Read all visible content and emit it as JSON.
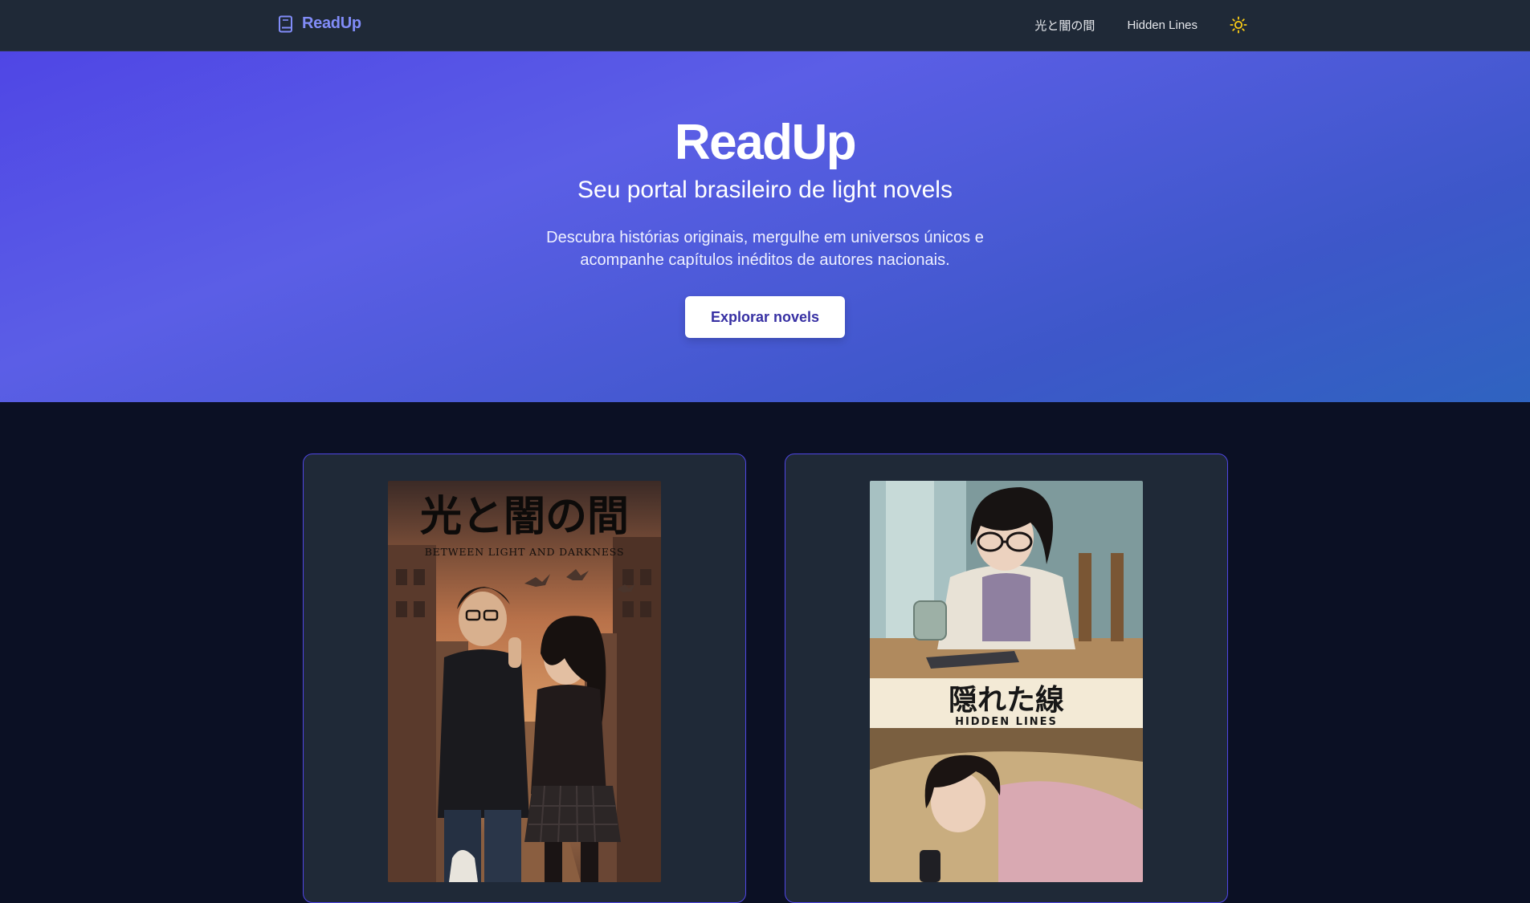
{
  "header": {
    "brand": "ReadUp",
    "nav": [
      {
        "label": "光と闇の間"
      },
      {
        "label": "Hidden Lines"
      }
    ],
    "theme_icon": "sun-icon"
  },
  "hero": {
    "title": "ReadUp",
    "subtitle": "Seu portal brasileiro de light novels",
    "description": "Descubra histórias originais, mergulhe em universos únicos e acompanhe capítulos inéditos de autores nacionais.",
    "cta": "Explorar novels"
  },
  "novels": [
    {
      "cover_title": "光と闇の間",
      "cover_subtitle": "BETWEEN LIGHT AND DARKNESS"
    },
    {
      "cover_title": "隠れた線",
      "cover_subtitle": "HIDDEN LINES"
    }
  ],
  "colors": {
    "brand": "#818cf8",
    "header_bg": "#1f2937",
    "page_bg": "#0b1024",
    "card_border": "#4f46e5",
    "cta_text": "#3730a3",
    "sun": "#facc15"
  }
}
